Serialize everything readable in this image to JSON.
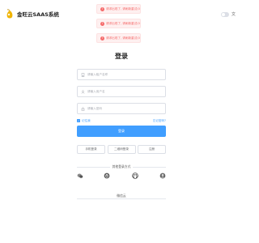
{
  "brand": {
    "title": "金旺云SAAS系统"
  },
  "toasts": [
    {
      "text": "请求出现了, 请刷新重试(01)"
    },
    {
      "text": "请求出现了, 请刷新重试(01)"
    },
    {
      "text": "请求出现了, 请刷新重试(01)"
    }
  ],
  "settings": {
    "dark_mode": false,
    "language_icon": "translate-icon"
  },
  "login": {
    "title": "登录",
    "tenant_placeholder": "请输入租户名称",
    "username_placeholder": "请输入用户名",
    "password_placeholder": "请输入密码",
    "remember_label": "记住我",
    "remember_checked": true,
    "forgot_label": "忘记密码?",
    "submit_label": "登录"
  },
  "alt_logins": {
    "phone": "手机登录",
    "qrcode": "二维码登录",
    "register": "注册"
  },
  "social": {
    "title": "其他登录方式",
    "icons": [
      "wechat-icon",
      "qq-icon",
      "github-icon",
      "avatar-icon"
    ]
  },
  "footer": {
    "register_text": "微信云"
  },
  "colors": {
    "primary": "#409eff",
    "error": "#f56c6c",
    "error_bg": "#fef0f0",
    "border": "#dcdfe6"
  }
}
